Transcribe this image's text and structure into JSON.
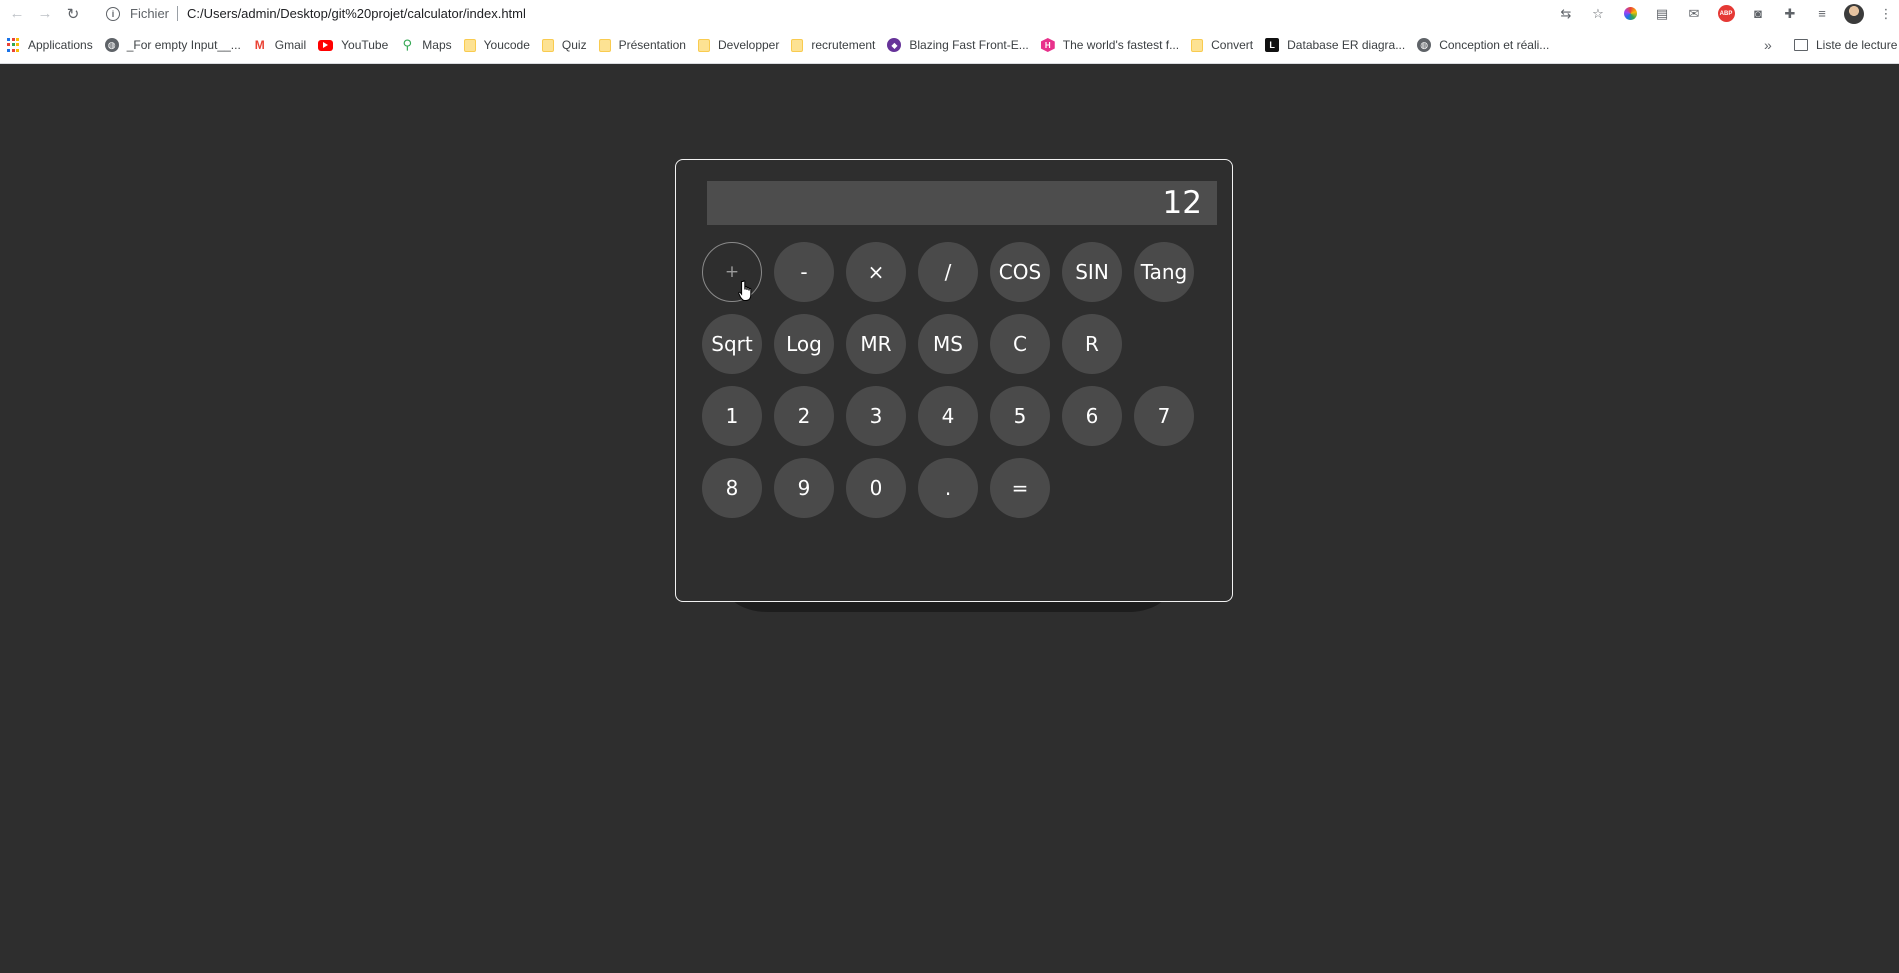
{
  "browser": {
    "scheme_label": "Fichier",
    "url": "C:/Users/admin/Desktop/git%20projet/calculator/index.html",
    "toolbar_icons": [
      "translate-icon",
      "star-icon",
      "color-wheel-icon",
      "calendar-icon",
      "mail-icon",
      "adblock-icon",
      "camera-icon",
      "extensions-icon",
      "media-icon",
      "profile-avatar"
    ],
    "adblock_label": "ABP",
    "bookmarks": [
      {
        "label": "Applications",
        "icon": "apps-grid-icon"
      },
      {
        "label": "_For empty Input__...",
        "icon": "globe-icon"
      },
      {
        "label": "Gmail",
        "icon": "gmail-icon"
      },
      {
        "label": "YouTube",
        "icon": "youtube-icon"
      },
      {
        "label": "Maps",
        "icon": "maps-pin-icon"
      },
      {
        "label": "Youcode",
        "icon": "folder-icon"
      },
      {
        "label": "Quiz",
        "icon": "folder-icon"
      },
      {
        "label": "Présentation",
        "icon": "folder-icon"
      },
      {
        "label": "Developper",
        "icon": "folder-icon"
      },
      {
        "label": "recrutement",
        "icon": "folder-icon"
      },
      {
        "label": "Blazing Fast Front-E...",
        "icon": "blazing-icon"
      },
      {
        "label": "The world's fastest f...",
        "icon": "hex-icon"
      },
      {
        "label": "Convert",
        "icon": "folder-icon"
      },
      {
        "label": "Database ER diagra...",
        "icon": "dbdiagram-icon"
      },
      {
        "label": "Conception et réali...",
        "icon": "globe-icon"
      }
    ],
    "more_bookmarks": "»",
    "reading_list": "Liste de lecture"
  },
  "calculator": {
    "display_value": "12",
    "rows": [
      [
        "+",
        "-",
        "×",
        "/",
        "COS",
        "SIN",
        "Tang"
      ],
      [
        "Sqrt",
        "Log",
        "MR",
        "MS",
        "C",
        "R"
      ],
      [
        "1",
        "2",
        "3",
        "4",
        "5",
        "6",
        "7"
      ],
      [
        "8",
        "9",
        "0",
        ".",
        "="
      ]
    ],
    "hovered_key": "+"
  },
  "colors": {
    "page_background": "#2e2e2e",
    "display_background": "#4d4d4d",
    "key_background": "#4a4a4a",
    "text": "#ffffff"
  }
}
